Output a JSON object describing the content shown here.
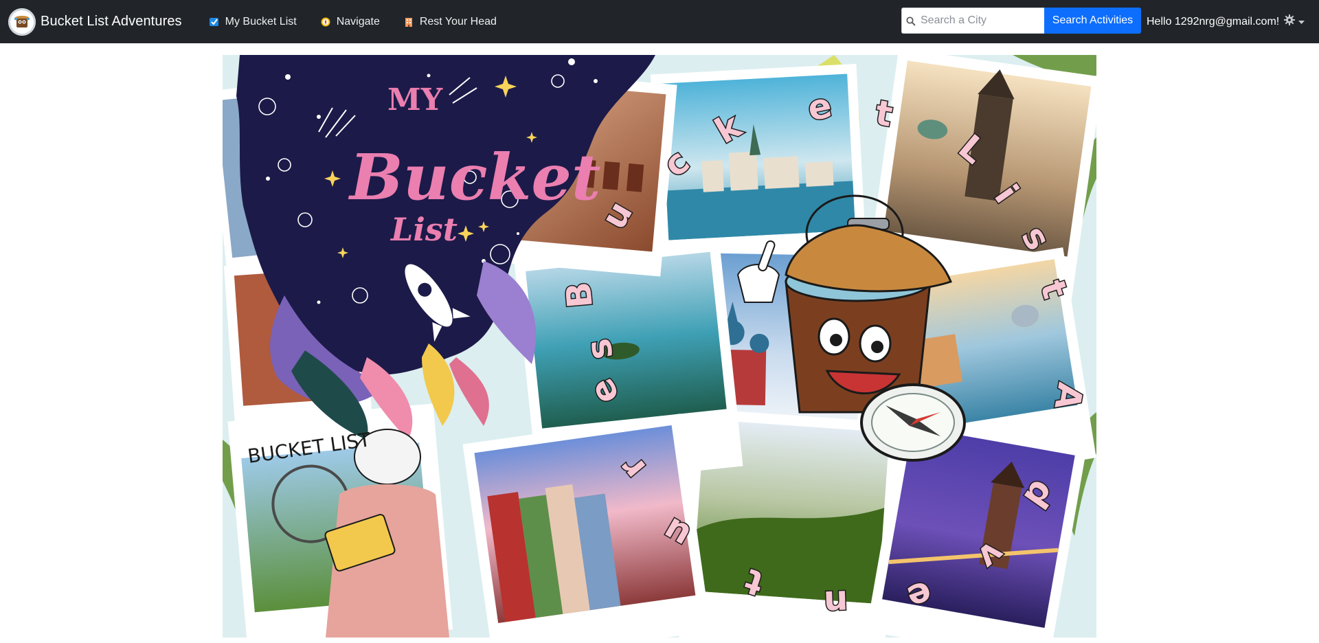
{
  "navbar": {
    "brand_title": "Bucket List Adventures",
    "links": [
      {
        "label": "My Bucket List",
        "icon": "checklist-icon"
      },
      {
        "label": "Navigate",
        "icon": "compass-icon"
      },
      {
        "label": "Rest Your Head",
        "icon": "hotel-icon"
      }
    ],
    "search": {
      "placeholder": "Search a City",
      "value": "",
      "button_label": "Search Activities"
    },
    "user": {
      "greeting": "Hello 1292nrg@gmail.com!",
      "icon": "gear-icon"
    }
  },
  "hero": {
    "art_text": {
      "my": "MY",
      "bucket": "Bucket",
      "list": "List",
      "notepad": "BUCKET LIST",
      "arc_letters": [
        "B",
        "u",
        "c",
        "k",
        "e",
        "t",
        " ",
        "L",
        "i",
        "s",
        "t",
        " ",
        "A",
        "d",
        "v",
        "e",
        "n",
        "t",
        "u",
        "r",
        "e",
        "s"
      ]
    }
  },
  "colors": {
    "navbar_bg": "#212529",
    "search_button": "#0d6efd",
    "poster_navy": "#1c1a48",
    "letter_pink": "#f7c7d3"
  }
}
